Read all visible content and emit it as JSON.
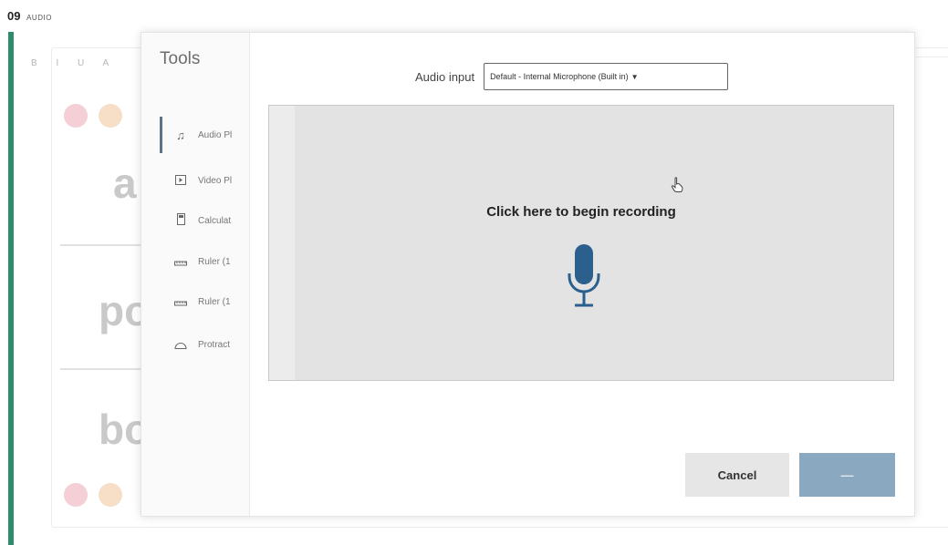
{
  "question": {
    "number": "09",
    "tag": "AUDIO"
  },
  "background": {
    "toolbar": "B I U A",
    "words": [
      "a",
      "po",
      "bo"
    ]
  },
  "modal": {
    "title": "Tools",
    "tools": [
      {
        "label": "Audio Pl",
        "icon": "music-note-icon",
        "active": true
      },
      {
        "label": "Video Pl",
        "icon": "video-player-icon",
        "active": false
      },
      {
        "label": "Calculat",
        "icon": "calculator-icon",
        "active": false
      },
      {
        "label": "Ruler (1",
        "icon": "ruler-icon",
        "active": false
      },
      {
        "label": "Ruler (1",
        "icon": "ruler-icon",
        "active": false
      },
      {
        "label": "Protract",
        "icon": "protractor-icon",
        "active": false
      }
    ],
    "audio_input": {
      "label": "Audio input",
      "selected": "Default - Internal Microphone (Built in)"
    },
    "recorder": {
      "prompt": "Click here to begin recording",
      "icon": "microphone-icon",
      "mic_color": "#2a5f8e"
    },
    "buttons": {
      "cancel": "Cancel",
      "ok": "—"
    }
  }
}
